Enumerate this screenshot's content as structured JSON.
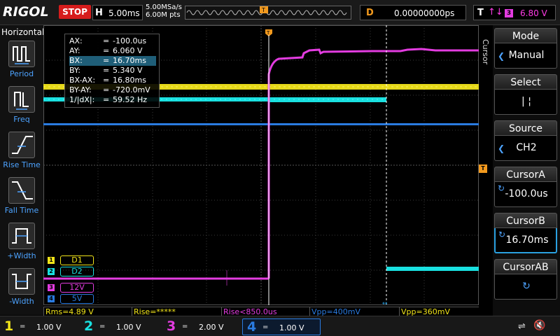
{
  "header": {
    "brand": "RIGOL",
    "run_state": "STOP",
    "timebase_label": "H",
    "timebase_value": "5.00ms",
    "sample_rate": "5.00MSa/s",
    "memory_depth": "6.00M pts",
    "delay_label": "D",
    "delay_value": "0.00000000ps",
    "trigger_label": "T",
    "trigger_source": "3",
    "trigger_level": "6.80 V"
  },
  "left_panel": {
    "title": "Horizontal",
    "items": [
      {
        "label": "Period",
        "icon": "period-icon"
      },
      {
        "label": "Freq",
        "icon": "freq-icon"
      },
      {
        "label": "Rise Time",
        "icon": "rise-time-icon"
      },
      {
        "label": "Fall Time",
        "icon": "fall-time-icon"
      },
      {
        "label": "+Width",
        "icon": "pos-width-icon"
      },
      {
        "label": "-Width",
        "icon": "neg-width-icon"
      }
    ]
  },
  "cursor_readout": {
    "rows": [
      {
        "k": "AX:",
        "v": "-100.0us"
      },
      {
        "k": "AY:",
        "v": "6.060 V"
      },
      {
        "k": "BX:",
        "v": "16.70ms"
      },
      {
        "k": "BY:",
        "v": "5.340 V"
      },
      {
        "k": "BX-AX:",
        "v": "16.80ms"
      },
      {
        "k": "BY-AY:",
        "v": "-720.0mV"
      },
      {
        "k": "1/|dX|:",
        "v": "59.52 Hz"
      }
    ],
    "eq": "="
  },
  "channel_tags": [
    {
      "num": "1",
      "label": "D1",
      "color": "#f2e51a"
    },
    {
      "num": "2",
      "label": "D2",
      "color": "#19e0e0"
    },
    {
      "num": "3",
      "label": "12V",
      "color": "#e33ce0"
    },
    {
      "num": "4",
      "label": "5V",
      "color": "#2a7be0"
    }
  ],
  "measurements": [
    {
      "text": "Rms=4.89 V",
      "color": "#f2e51a"
    },
    {
      "text": "Rise=*****",
      "color": "#f2e51a"
    },
    {
      "text": "Rise<850.0us",
      "color": "#e33ce0"
    },
    {
      "text": "Vpp=400mV",
      "color": "#2a7be0"
    },
    {
      "text": "Vpp=360mV",
      "color": "#f2e51a"
    }
  ],
  "channels": [
    {
      "num": "1",
      "coupling": "=",
      "scale": "1.00 V",
      "color": "#f2e51a"
    },
    {
      "num": "2",
      "coupling": "=",
      "scale": "1.00 V",
      "color": "#19e0e0"
    },
    {
      "num": "3",
      "coupling": "=",
      "scale": "2.00 V",
      "color": "#e33ce0"
    },
    {
      "num": "4",
      "coupling": "=",
      "scale": "1.00 V",
      "color": "#2a7be0"
    }
  ],
  "right_panel": {
    "side_title": "Cursor",
    "mode_label": "Mode",
    "mode_value": "Manual",
    "select_label": "Select",
    "select_value": "| ¦",
    "source_label": "Source",
    "source_value": "CH2",
    "cursor_a_label": "CursorA",
    "cursor_a_value": "-100.0us",
    "cursor_b_label": "CursorB",
    "cursor_b_value": "16.70ms",
    "cursor_ab_label": "CursorAB",
    "cursor_ab_icon": "knob-icon"
  },
  "colors": {
    "ch1": "#f2e51a",
    "ch2": "#19e0e0",
    "ch3": "#e33ce0",
    "ch4": "#2a7be0",
    "accent": "#f39a1e",
    "stop": "#d61c1c"
  }
}
